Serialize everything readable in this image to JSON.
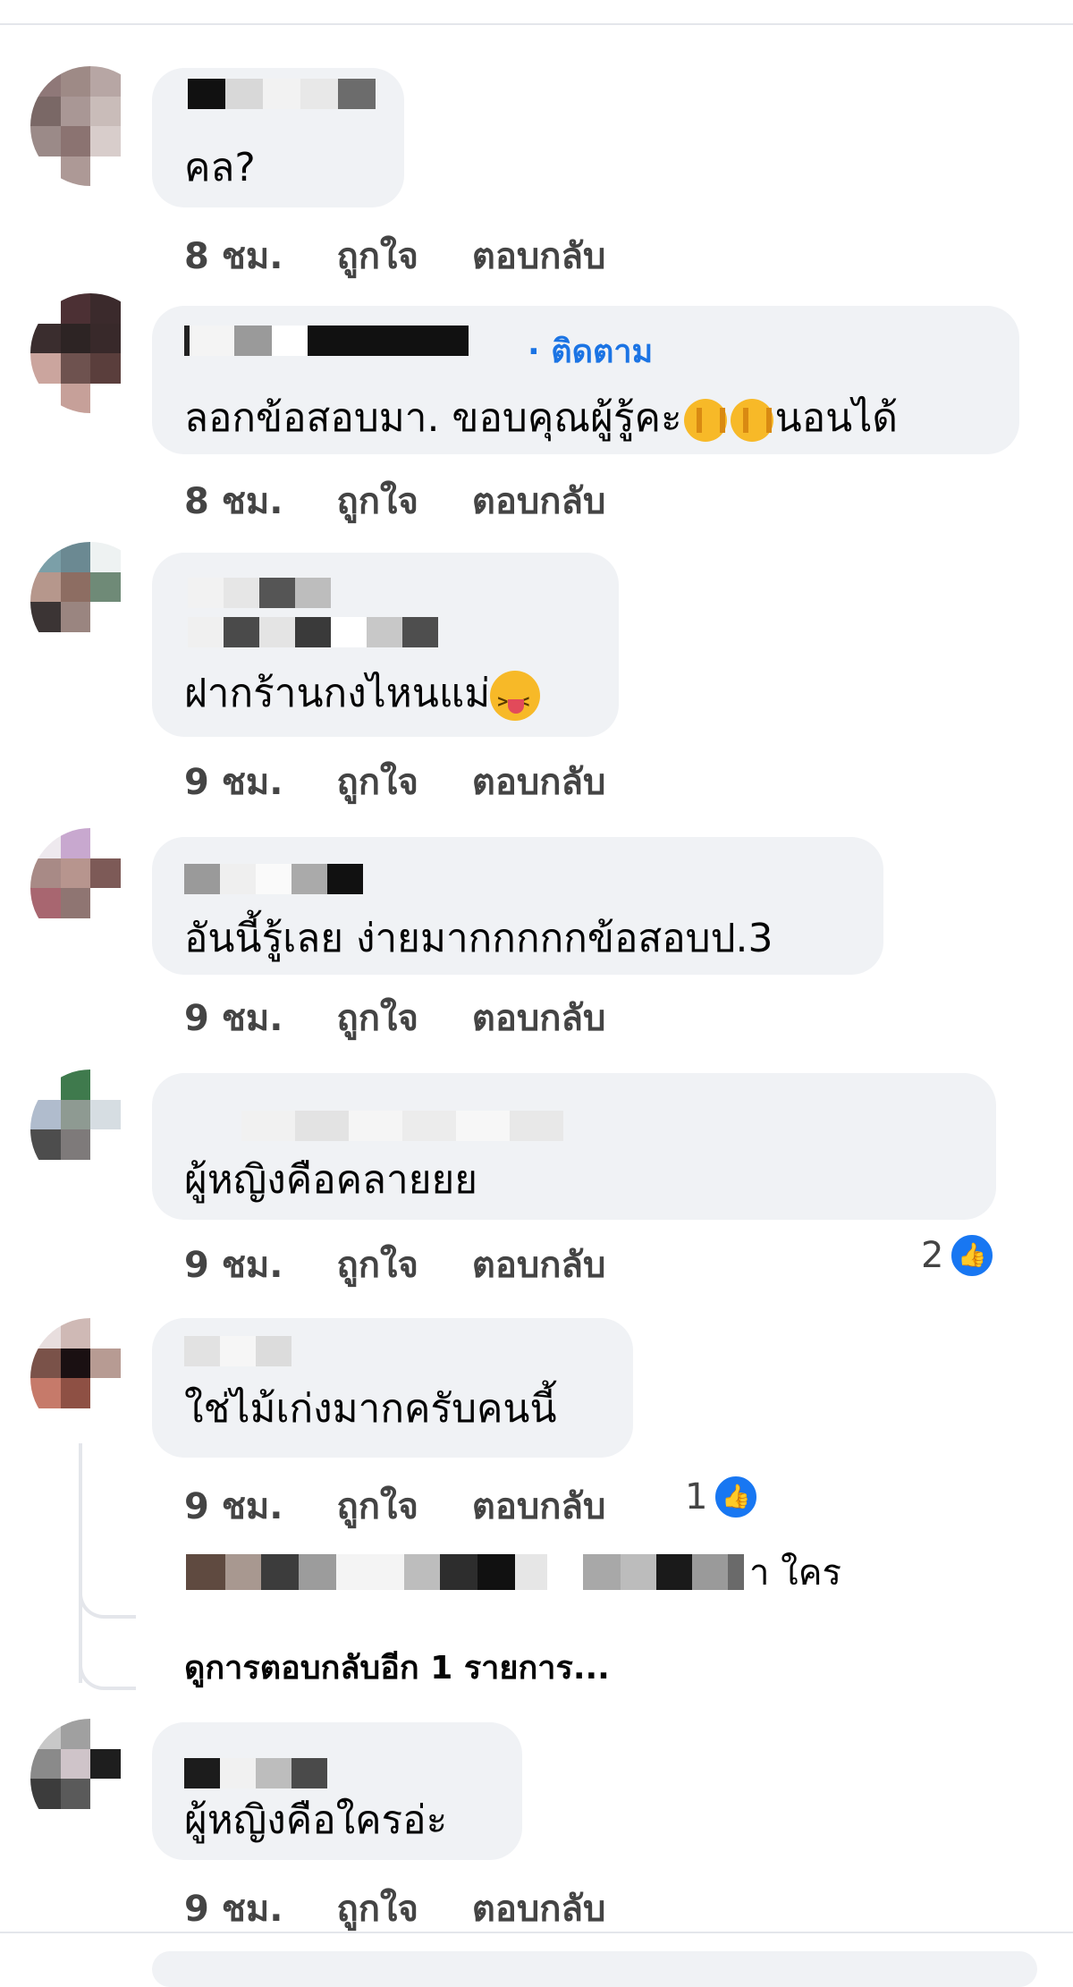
{
  "comments": [
    {
      "text": "คล?",
      "time": "8 ชม.",
      "like": "ถูกใจ",
      "reply": "ตอบกลับ"
    },
    {
      "text": "ลอกข้อสอบมา. ขอบคุณผู้รู้คะ",
      "text_tail": "นอนได้",
      "follow": "· ติดตาม",
      "time": "8 ชม.",
      "like": "ถูกใจ",
      "reply": "ตอบกลับ"
    },
    {
      "text": "ฝากร้านกงไหนแม่",
      "time": "9 ชม.",
      "like": "ถูกใจ",
      "reply": "ตอบกลับ"
    },
    {
      "text": "อันนี้รู้เลย ง่ายมากกกกกข้อสอบป.3",
      "time": "9 ชม.",
      "like": "ถูกใจ",
      "reply": "ตอบกลับ"
    },
    {
      "text": "ผู้หญิงคือคลายยย",
      "time": "9 ชม.",
      "like": "ถูกใจ",
      "reply": "ตอบกลับ",
      "reaction_count": "2"
    },
    {
      "text": "ใช่ไม้เก่งมากครับคนนี้",
      "time": "9 ชม.",
      "like": "ถูกใจ",
      "reply": "ตอบกลับ",
      "reaction_count": "1",
      "reply_preview_text": "า ใคร",
      "see_more_replies": "ดูการตอบกลับอีก 1 รายการ..."
    },
    {
      "text": "ผู้หญิงคือใครอ่ะ",
      "time": "9 ชม.",
      "like": "ถูกใจ",
      "reply": "ตอบกลับ"
    }
  ],
  "icons": {
    "like": "like-thumb-icon",
    "hand": "love-you-hand-emoji",
    "face": "squinting-tongue-emoji"
  },
  "colors": {
    "bubble": "#f0f2f5",
    "follow": "#1b74e4",
    "like_badge": "#1877f2"
  }
}
